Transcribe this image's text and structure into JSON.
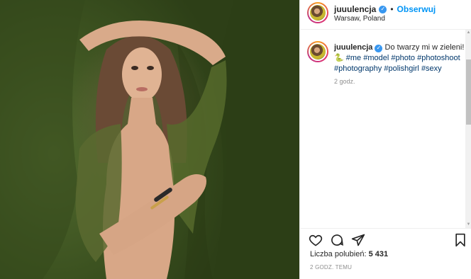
{
  "post": {
    "username": "juuulencja",
    "follow_label": "Obserwuj",
    "location": "Warsaw, Poland",
    "caption_text": "Do twarzy mi w zieleni!",
    "caption_emoji": "🐍",
    "hashtags": [
      "#me",
      "#model",
      "#photo",
      "#photoshoot",
      "#photography",
      "#polishgirl",
      "#sexy"
    ],
    "caption_time": "2 godz.",
    "likes_label": "Liczba polubień:",
    "likes_count": "5 431",
    "post_time": "2 GODZ. TEMU"
  },
  "icons": {
    "like": "heart-icon",
    "comment": "comment-icon",
    "share": "share-icon",
    "save": "bookmark-icon",
    "verified": "verified-badge-icon"
  },
  "colors": {
    "link_blue": "#0095f6",
    "hashtag": "#00376b",
    "verified": "#3897f0",
    "muted": "#8e8e8e"
  }
}
